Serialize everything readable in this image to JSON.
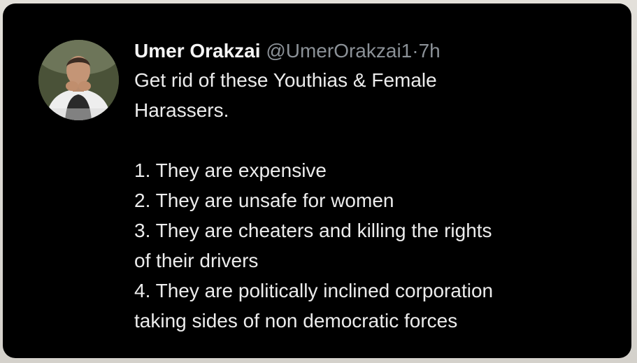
{
  "tweet": {
    "display_name": "Umer Orakzai",
    "handle": "@UmerOrakzai1",
    "separator": "·",
    "time": "7h",
    "lines": [
      "Get rid of these Youthias & Female",
      "Harassers.",
      "",
      "1. They are expensive",
      "2. They are unsafe for women",
      "3. They are cheaters and killing the rights",
      "of their drivers",
      "4. They are politically inclined corporation",
      "taking sides of non democratic forces"
    ]
  },
  "colors": {
    "card_background": "#000000",
    "text_primary": "#e7e9ea",
    "text_secondary": "#8b9197",
    "frame_background": "#d9d6d0"
  }
}
